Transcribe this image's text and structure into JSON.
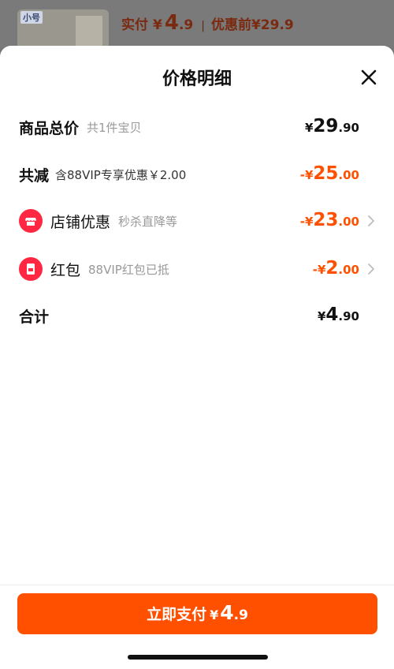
{
  "background_strip": {
    "thumb_label": "小号",
    "paid_label": "实付",
    "currency": "¥",
    "paid_int": "4",
    "paid_dec": ".9",
    "separator": "|",
    "orig_label": "优惠前¥29.9"
  },
  "sheet": {
    "title": "价格明细",
    "close_icon": "close-icon"
  },
  "rows": {
    "total": {
      "name": "商品总价",
      "sub": "共1件宝贝",
      "yen": "¥",
      "int": "29",
      "dec": ".90"
    },
    "reduce": {
      "name": "共减",
      "sub": "含88VIP专享优惠￥2.00",
      "yen": "-¥",
      "int": "25",
      "dec": ".00"
    },
    "shop": {
      "name": "店铺优惠",
      "sub": "秒杀直降等",
      "yen": "-¥",
      "int": "23",
      "dec": ".00",
      "icon": "shop-icon"
    },
    "redpacket": {
      "name": "红包",
      "sub": "88VIP红包已抵",
      "yen": "-¥",
      "int": "2",
      "dec": ".00",
      "icon": "red-packet-icon"
    },
    "sum": {
      "name": "合计",
      "yen": "¥",
      "int": "4",
      "dec": ".90"
    }
  },
  "pay_button": {
    "label": "立即支付",
    "yen": "¥",
    "int": "4",
    "dec": ".9"
  },
  "colors": {
    "accent": "#ff5000",
    "icon_red": "#ff2741"
  }
}
